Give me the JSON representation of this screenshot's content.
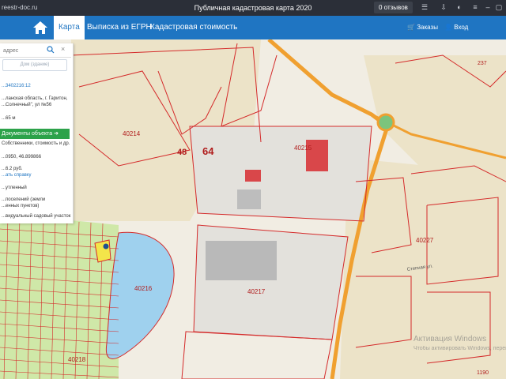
{
  "browser": {
    "url": "reestr-doc.ru",
    "title": "Публичная кадастровая карта 2020",
    "reviews": "0 отзывов"
  },
  "nav": {
    "items": [
      "Карта",
      "Выписка из ЕГРН",
      "Кадастровая стоимость"
    ],
    "orders": "Заказы",
    "login": "Вход"
  },
  "panel": {
    "search_placeholder": "адрес",
    "type_button": "Дом (здание)",
    "number": "...3402216:12",
    "address_lines": [
      "...ланская область, г. Гаритон,",
      "...Солнечный\", ул №56"
    ],
    "area": "...65 м",
    "docs_button": "Документы объекта",
    "docs_sub": "Собственники, стоимость и др.",
    "coords": "...0950, 46.899866",
    "price": "...6.2 руб.",
    "price_link": "...ать справку",
    "category": "...утленный",
    "purpose_lines": [
      "...поселений (земли",
      "...енных пунктов)"
    ],
    "usage": "...видуальный садовый участок"
  },
  "map": {
    "labels": [
      "48",
      "64",
      "40214",
      "40215",
      "40217",
      "40227",
      "40218",
      "40216",
      "237",
      "1190"
    ],
    "street": "Степная ул."
  },
  "watermark": {
    "line1": "Активация Windows",
    "line2": "Чтобы активировать Windows, перейдите в раздел «Параметры»."
  },
  "colors": {
    "nav": "#1f75c2",
    "parcel_line": "#d42a2a",
    "water": "#9fd1ee",
    "road": "#f0a030",
    "docs_button": "#2ca24a"
  }
}
